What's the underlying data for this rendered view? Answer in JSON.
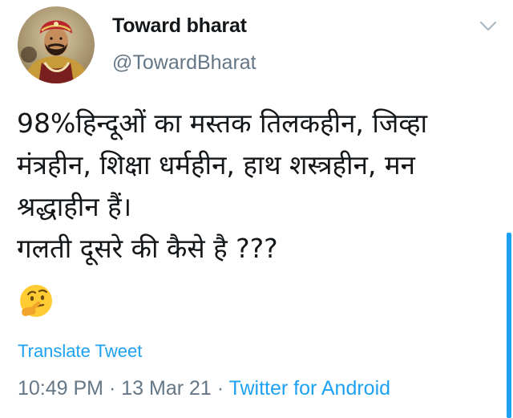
{
  "author": {
    "display_name": "Toward bharat",
    "handle": "@TowardBharat",
    "avatar_icon": "profile-portrait-avatar"
  },
  "menu_icon": "chevron-down-icon",
  "tweet": {
    "lines": [
      "98%हिन्दूओं का मस्तक तिलकहीन, जिव्हा",
      "मंत्रहीन, शिक्षा धर्महीन, हाथ शस्त्रहीन, मन",
      "श्रद्धाहीन हैं।",
      "गलती दूसरे की कैसे है ???"
    ],
    "emoji": "thinking-face-emoji"
  },
  "translate_label": "Translate Tweet",
  "meta": {
    "time": "10:49 PM",
    "separator": " · ",
    "date": "13 Mar 21",
    "separator2": " · ",
    "source": "Twitter for Android"
  },
  "colors": {
    "link": "#1da1f2",
    "secondary_text": "#657786",
    "primary_text": "#14171a"
  }
}
